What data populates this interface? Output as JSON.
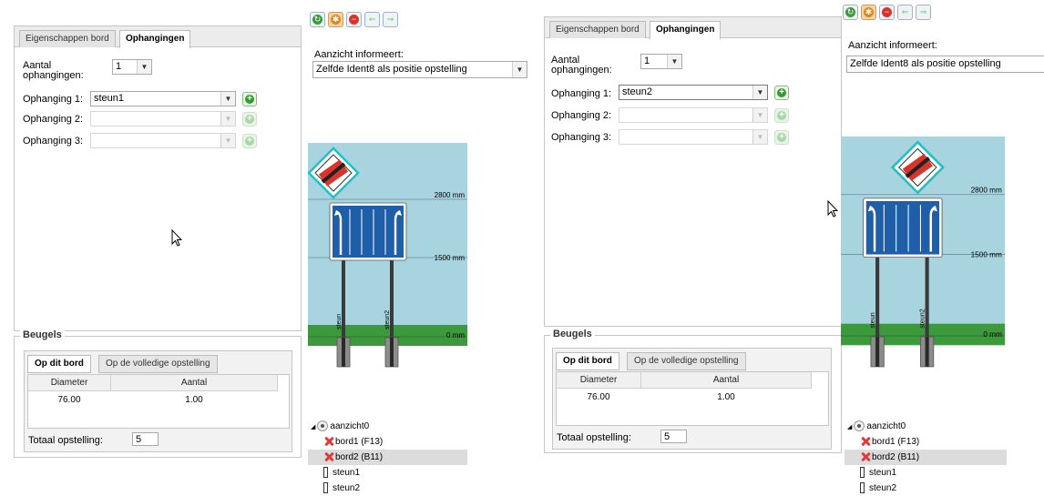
{
  "screens": [
    {
      "tabs": [
        "Eigenschappen bord",
        "Ophangingen"
      ],
      "aantal_label": "Aantal\nophangingen:",
      "aantal_value": "1",
      "ophangingen": [
        {
          "label": "Ophanging 1:",
          "value": "steun1"
        },
        {
          "label": "Ophanging 2:",
          "value": ""
        },
        {
          "label": "Ophanging 3:",
          "value": ""
        }
      ],
      "beugels": {
        "legend": "Beugels",
        "tabs": [
          "Op dit bord",
          "Op de volledige opstelling"
        ],
        "columns": [
          "Diameter",
          "Aantal"
        ],
        "rows": [
          [
            "76.00",
            "1.00"
          ]
        ],
        "totaal_label": "Totaal opstelling:",
        "totaal_value": "5"
      },
      "view": {
        "aanzicht_label": "Aanzicht informeert:",
        "aanzicht_value": "Zelfde Ident8 als positie opstelling",
        "dim_labels": [
          "2800 mm",
          "1500 mm",
          "0 mm"
        ],
        "pole_labels": [
          "steun",
          "steun2"
        ]
      },
      "tree": [
        {
          "text": "aanzicht0",
          "icon": "eye-icon",
          "indent": 0
        },
        {
          "text": "bord1 (F13)",
          "icon": "x-icon",
          "indent": 1
        },
        {
          "text": "bord2 (B11)",
          "icon": "x-icon",
          "indent": 1,
          "selected": true
        },
        {
          "text": "steun1",
          "icon": "pole-icon",
          "indent": 0
        },
        {
          "text": "steun2",
          "icon": "pole-icon",
          "indent": 0
        }
      ]
    },
    {
      "tabs": [
        "Eigenschappen bord",
        "Ophangingen"
      ],
      "aantal_label": "Aantal\nophangingen:",
      "aantal_value": "1",
      "ophangingen": [
        {
          "label": "Ophanging 1:",
          "value": "steun2"
        },
        {
          "label": "Ophanging 2:",
          "value": ""
        },
        {
          "label": "Ophanging 3:",
          "value": ""
        }
      ],
      "beugels": {
        "legend": "Beugels",
        "tabs": [
          "Op dit bord",
          "Op de volledige opstelling"
        ],
        "columns": [
          "Diameter",
          "Aantal"
        ],
        "rows": [
          [
            "76.00",
            "1.00"
          ]
        ],
        "totaal_label": "Totaal opstelling:",
        "totaal_value": "5"
      },
      "view": {
        "aanzicht_label": "Aanzicht informeert:",
        "aanzicht_value": "Zelfde Ident8 als positie opstelling",
        "dim_labels": [
          "2800 mm",
          "1500 mm",
          "0 mm"
        ],
        "pole_labels": [
          "steun",
          "steun2"
        ]
      },
      "tree": [
        {
          "text": "aanzicht0",
          "icon": "eye-icon",
          "indent": 0
        },
        {
          "text": "bord1 (F13)",
          "icon": "x-icon",
          "indent": 1
        },
        {
          "text": "bord2 (B11)",
          "icon": "x-icon",
          "indent": 1,
          "selected": true
        },
        {
          "text": "steun1",
          "icon": "pole-icon",
          "indent": 0
        },
        {
          "text": "steun2",
          "icon": "pole-icon",
          "indent": 0
        }
      ]
    }
  ],
  "colors": {
    "sky": "#a8d4e0",
    "grass": "#3c9a3c",
    "sign_blue": "#1f5ea8",
    "warning_red": "#d9342b"
  }
}
